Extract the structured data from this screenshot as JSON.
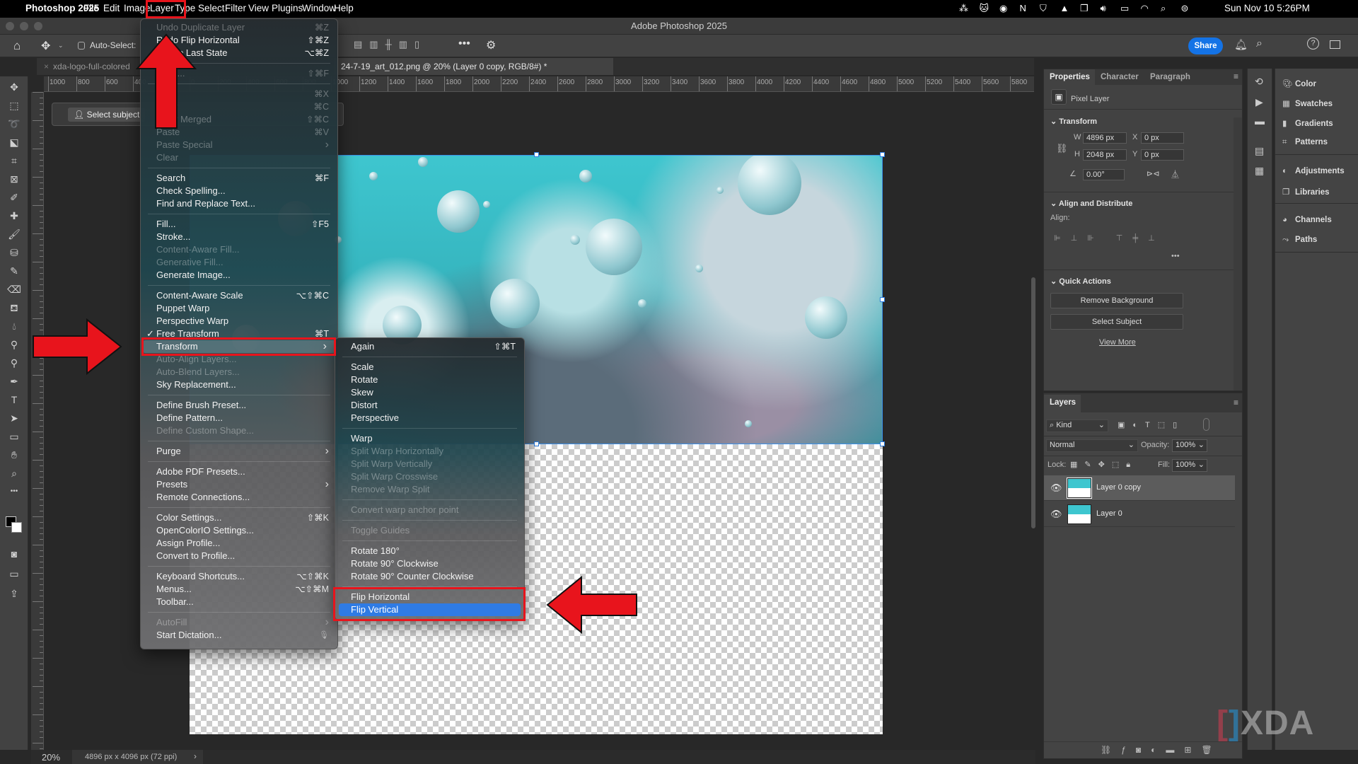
{
  "menubar": {
    "apple_icon": "apple-icon",
    "app_name": "Photoshop 2025",
    "items": [
      "File",
      "Edit",
      "Image",
      "Layer",
      "Type",
      "Select",
      "Filter",
      "View",
      "Plugins",
      "Window",
      "Help"
    ],
    "status_icons": [
      "group-icon",
      "cat-icon",
      "camera-icon",
      "notion-icon",
      "shield-icon",
      "drive-icon",
      "window-icon",
      "volume-icon",
      "battery-icon",
      "wifi-icon",
      "search-icon",
      "control-center-icon"
    ],
    "datetime": "Sun Nov 10  5:26PM"
  },
  "window": {
    "title": "Adobe Photoshop 2025"
  },
  "options": {
    "auto_select": "Auto-Select:",
    "share": "Share",
    "select_subject": "Select subject"
  },
  "tabs": [
    {
      "label": "xda-logo-full-colored"
    },
    {
      "label": "24-7-19_art_012.png @ 20% (Layer 0 copy, RGB/8#) *"
    }
  ],
  "ruler_labels": [
    1000,
    800,
    600,
    400,
    200,
    0,
    200,
    400,
    600,
    800,
    1000,
    1200,
    1400,
    1600,
    1800,
    2000,
    2200,
    2400,
    2600,
    2800,
    3000,
    3200,
    3400,
    3600,
    3800,
    4000,
    4200,
    4400,
    4600,
    4800,
    5000,
    5200,
    5400,
    5600,
    5800
  ],
  "status": {
    "zoom": "20%",
    "doc_size": "4896 px x 4096 px (72 ppi)"
  },
  "edit_menu": [
    {
      "label": "Undo Duplicate Layer",
      "shortcut": "⌘Z",
      "disabled": true
    },
    {
      "label": "Redo Flip Horizontal",
      "shortcut": "⇧⌘Z"
    },
    {
      "label": "Toggle Last State",
      "shortcut": "⌥⌘Z"
    },
    {
      "sep": true
    },
    {
      "label": "Fade...",
      "shortcut": "⇧⌘F",
      "disabled": true
    },
    {
      "sep": true
    },
    {
      "label": "Cut",
      "shortcut": "⌘X",
      "disabled": true
    },
    {
      "label": "Copy",
      "shortcut": "⌘C",
      "disabled": true
    },
    {
      "label": "Copy Merged",
      "shortcut": "⇧⌘C",
      "disabled": true
    },
    {
      "label": "Paste",
      "shortcut": "⌘V",
      "disabled": true
    },
    {
      "label": "Paste Special",
      "submenu": true,
      "disabled": true
    },
    {
      "label": "Clear",
      "disabled": true
    },
    {
      "sep": true
    },
    {
      "label": "Search",
      "shortcut": "⌘F"
    },
    {
      "label": "Check Spelling..."
    },
    {
      "label": "Find and Replace Text..."
    },
    {
      "sep": true
    },
    {
      "label": "Fill...",
      "shortcut": "⇧F5"
    },
    {
      "label": "Stroke..."
    },
    {
      "label": "Content-Aware Fill...",
      "disabled": true
    },
    {
      "label": "Generative Fill...",
      "disabled": true
    },
    {
      "label": "Generate Image..."
    },
    {
      "sep": true
    },
    {
      "label": "Content-Aware Scale",
      "shortcut": "⌥⇧⌘C"
    },
    {
      "label": "Puppet Warp"
    },
    {
      "label": "Perspective Warp"
    },
    {
      "label": "Free Transform",
      "shortcut": "⌘T",
      "checked": true
    },
    {
      "label": "Transform",
      "submenu": true,
      "highlighted": true
    },
    {
      "label": "Auto-Align Layers...",
      "disabled": true
    },
    {
      "label": "Auto-Blend Layers...",
      "disabled": true
    },
    {
      "label": "Sky Replacement..."
    },
    {
      "sep": true
    },
    {
      "label": "Define Brush Preset..."
    },
    {
      "label": "Define Pattern..."
    },
    {
      "label": "Define Custom Shape...",
      "disabled": true
    },
    {
      "sep": true
    },
    {
      "label": "Purge",
      "submenu": true
    },
    {
      "sep": true
    },
    {
      "label": "Adobe PDF Presets..."
    },
    {
      "label": "Presets",
      "submenu": true
    },
    {
      "label": "Remote Connections..."
    },
    {
      "sep": true
    },
    {
      "label": "Color Settings...",
      "shortcut": "⇧⌘K"
    },
    {
      "label": "OpenColorIO Settings..."
    },
    {
      "label": "Assign Profile..."
    },
    {
      "label": "Convert to Profile..."
    },
    {
      "sep": true
    },
    {
      "label": "Keyboard Shortcuts...",
      "shortcut": "⌥⇧⌘K"
    },
    {
      "label": "Menus...",
      "shortcut": "⌥⇧⌘M"
    },
    {
      "label": "Toolbar..."
    },
    {
      "sep": true
    },
    {
      "label": "AutoFill",
      "submenu": true,
      "disabled": true
    },
    {
      "label": "Start Dictation...",
      "icon": "microphone-icon"
    }
  ],
  "transform_menu": [
    {
      "label": "Again",
      "shortcut": "⇧⌘T"
    },
    {
      "sep": true
    },
    {
      "label": "Scale"
    },
    {
      "label": "Rotate"
    },
    {
      "label": "Skew"
    },
    {
      "label": "Distort"
    },
    {
      "label": "Perspective"
    },
    {
      "sep": true
    },
    {
      "label": "Warp"
    },
    {
      "label": "Split Warp Horizontally",
      "disabled": true
    },
    {
      "label": "Split Warp Vertically",
      "disabled": true
    },
    {
      "label": "Split Warp Crosswise",
      "disabled": true
    },
    {
      "label": "Remove Warp Split",
      "disabled": true
    },
    {
      "sep": true
    },
    {
      "label": "Convert warp anchor point",
      "disabled": true
    },
    {
      "sep": true
    },
    {
      "label": "Toggle Guides",
      "disabled": true
    },
    {
      "sep": true
    },
    {
      "label": "Rotate 180°"
    },
    {
      "label": "Rotate 90° Clockwise"
    },
    {
      "label": "Rotate 90° Counter Clockwise"
    },
    {
      "sep": true
    },
    {
      "label": "Flip Horizontal"
    },
    {
      "label": "Flip Vertical",
      "selected": true
    }
  ],
  "properties": {
    "tabs": [
      "Properties",
      "Character",
      "Paragraph"
    ],
    "layer_type": "Pixel Layer",
    "transform": {
      "title": "Transform",
      "w_label": "W",
      "w": "4896 px",
      "h_label": "H",
      "h": "2048 px",
      "x_label": "X",
      "x": "0 px",
      "y_label": "Y",
      "y": "0 px",
      "angle": "0.00°"
    },
    "align": {
      "title": "Align and Distribute",
      "label": "Align:"
    },
    "quick": {
      "title": "Quick Actions",
      "remove_bg": "Remove Background",
      "select_subject": "Select Subject",
      "view_more": "View More"
    }
  },
  "right_panels": [
    {
      "label": "Color",
      "icon": "palette-icon"
    },
    {
      "label": "Swatches",
      "icon": "grid-icon"
    },
    {
      "label": "Gradients",
      "icon": "gradient-icon"
    },
    {
      "label": "Patterns",
      "icon": "pattern-icon"
    },
    {
      "label": "Adjustments",
      "icon": "adjustments-icon"
    },
    {
      "label": "Libraries",
      "icon": "libraries-icon"
    },
    {
      "label": "Channels",
      "icon": "channels-icon"
    },
    {
      "label": "Paths",
      "icon": "paths-icon"
    }
  ],
  "layers": {
    "title": "Layers",
    "kind": "Kind",
    "blend": "Normal",
    "opacity_label": "Opacity:",
    "opacity": "100%",
    "lock_label": "Lock:",
    "fill_label": "Fill:",
    "fill": "100%",
    "items": [
      {
        "name": "Layer 0 copy",
        "selected": true,
        "visible": true
      },
      {
        "name": "Layer 0",
        "selected": false,
        "visible": true
      }
    ]
  },
  "watermark": "XDA",
  "colors": {
    "accent": "#2f7be4",
    "annotation": "#e8141c",
    "share": "#1473e6"
  }
}
